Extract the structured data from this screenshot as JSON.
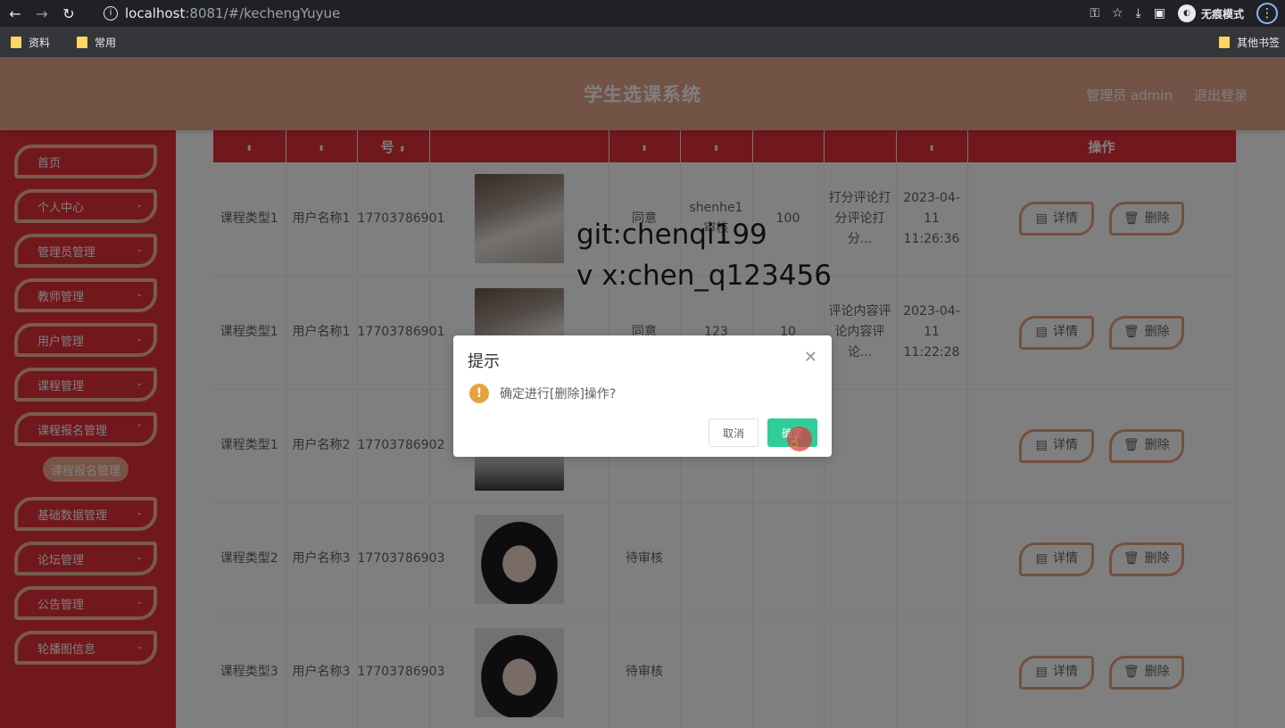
{
  "browser": {
    "url_host": "localhost",
    "url_path": ":8081/#/kechengYuyue",
    "incognito_label": "无痕模式",
    "bookmarks": [
      "资料",
      "常用"
    ],
    "bookmarks_right": "其他书签"
  },
  "header": {
    "title": "学生选课系统",
    "user": "管理员 admin",
    "logout": "退出登录"
  },
  "sidebar": {
    "items": [
      "首页",
      "个人中心",
      "管理员管理",
      "教师管理",
      "用户管理",
      "课程管理",
      "课程报名管理",
      "基础数据管理",
      "论坛管理",
      "公告管理",
      "轮播图信息"
    ],
    "sub_item": "课程报名管理"
  },
  "table": {
    "headers": [
      "",
      "",
      "号",
      "",
      "",
      "",
      "",
      "",
      "",
      "操作"
    ],
    "rows": [
      {
        "type": "课程类型1",
        "user": "用户名称1",
        "phone": "17703786901",
        "status": "同意",
        "reviewer": "shenhe1",
        "extra": "审核",
        "score": "100",
        "comment": "打分评论打分评论打分...",
        "time": "2023-04-11 11:26:36"
      },
      {
        "type": "课程类型1",
        "user": "用户名称1",
        "phone": "17703786901",
        "status": "同意",
        "reviewer": "123",
        "extra": "",
        "score": "10",
        "comment": "评论内容评论内容评论...",
        "time": "2023-04-11 11:22:28"
      },
      {
        "type": "课程类型1",
        "user": "用户名称2",
        "phone": "17703786902",
        "status": "",
        "reviewer": "",
        "extra": "",
        "score": "",
        "comment": "",
        "time": ""
      },
      {
        "type": "课程类型2",
        "user": "用户名称3",
        "phone": "17703786903",
        "status": "待审核",
        "reviewer": "",
        "extra": "",
        "score": "",
        "comment": "",
        "time": ""
      },
      {
        "type": "课程类型3",
        "user": "用户名称3",
        "phone": "17703786903",
        "status": "待审核",
        "reviewer": "",
        "extra": "",
        "score": "",
        "comment": "",
        "time": ""
      }
    ],
    "detail_label": "详情",
    "delete_label": "删除"
  },
  "watermark": {
    "line1": "git:chenqi199",
    "line2": "v x:chen_q123456"
  },
  "dialog": {
    "title": "提示",
    "message": "确定进行[删除]操作?",
    "cancel": "取消",
    "confirm": "确定"
  }
}
